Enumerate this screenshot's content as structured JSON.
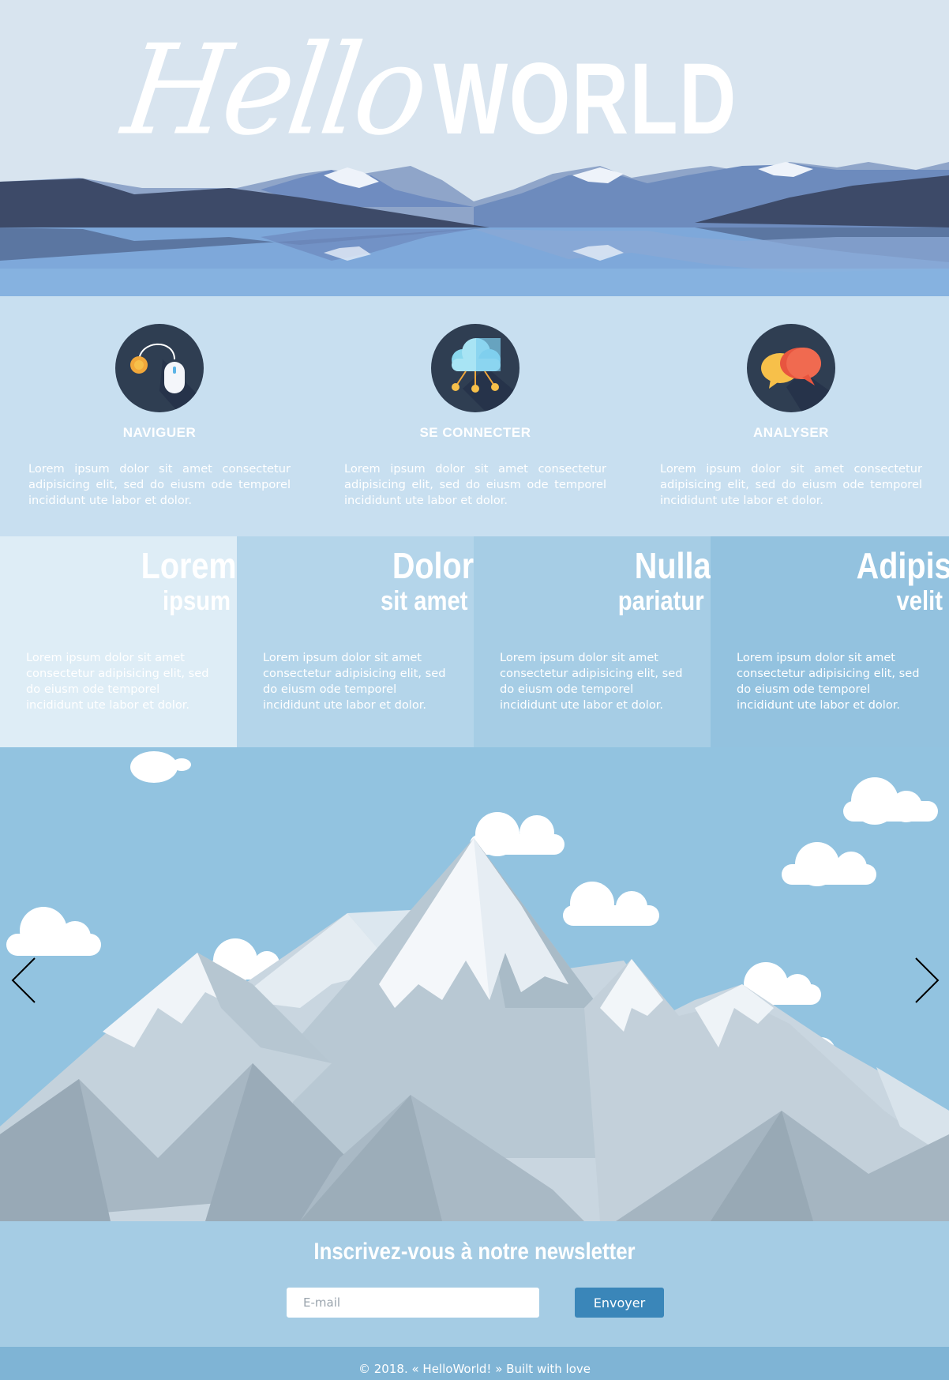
{
  "hero": {
    "title_script": "Hello",
    "title_bold": "WORLD"
  },
  "features": [
    {
      "icon": "mouse-coin-icon",
      "title": "NAVIGUER",
      "text": "Lorem ipsum dolor sit amet consectetur adipisicing elit, sed do eiusm ode temporel incididunt ute labor et dolor."
    },
    {
      "icon": "cloud-network-icon",
      "title": "SE CONNECTER",
      "text": "Lorem ipsum dolor sit amet consectetur adipisicing elit, sed do eiusm ode temporel incididunt ute labor et dolor."
    },
    {
      "icon": "chat-bubbles-icon",
      "title": "ANALYSER",
      "text": "Lorem ipsum dolor sit amet consectetur adipisicing elit, sed do eiusm ode temporel incididunt ute labor et dolor."
    }
  ],
  "columns": [
    {
      "big": "Lorem",
      "small": "ipsum",
      "text": "Lorem ipsum dolor sit amet consectetur adipisicing elit, sed do eiusm ode temporel incididunt ute labor et dolor.",
      "bg": "#deedf6"
    },
    {
      "big": "Dolor",
      "small": "sit amet",
      "text": "Lorem ipsum dolor sit amet consectetur adipisicing elit, sed do eiusm ode temporel incididunt ute labor et dolor.",
      "bg": "#b4d5ea"
    },
    {
      "big": "Nulla",
      "small": "pariatur",
      "text": "Lorem ipsum dolor sit amet consectetur adipisicing elit, sed do eiusm ode temporel incididunt ute labor et dolor.",
      "bg": "#a6cde5"
    },
    {
      "big": "Adipis",
      "small": "velit",
      "text": "Lorem ipsum dolor sit amet consectetur adipisicing elit, sed do eiusm ode temporel incididunt ute labor et dolor.",
      "bg": "#93c2df"
    }
  ],
  "slider": {
    "prev_icon": "chevron-left-icon",
    "next_icon": "chevron-right-icon"
  },
  "newsletter": {
    "title": "Inscrivez-vous à notre newsletter",
    "email_placeholder": "E-mail",
    "button_label": "Envoyer"
  },
  "footer": {
    "text": "© 2018. « HelloWorld! » Built with love"
  },
  "colors": {
    "hero_bg": "#d8e4ef",
    "features_bg": "#c8dff0",
    "sky": "#92c3e0",
    "newsletter_bg": "#a5cce4",
    "button": "#3a86b9",
    "footer_bg": "#7fb4d5"
  }
}
